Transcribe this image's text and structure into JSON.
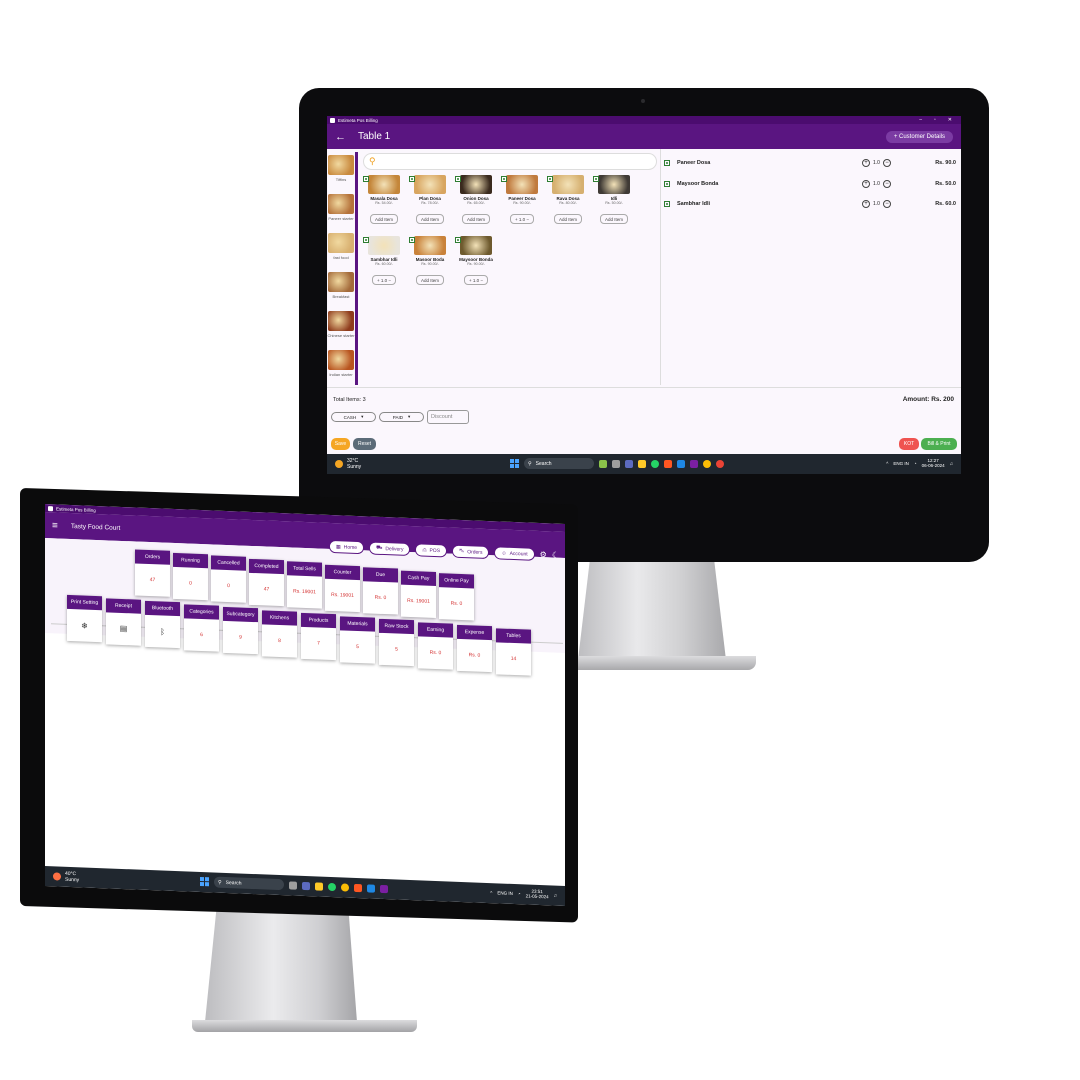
{
  "pos_screen": {
    "window_title": "Estimeta Pos Billing",
    "header_title": "Table 1",
    "customer_details_label": "+ Customer Details",
    "categories": [
      {
        "label": "Tiffins",
        "color": "#c98a3e"
      },
      {
        "label": "Paneer starter",
        "color": "#b5723a"
      },
      {
        "label": "fast food",
        "color": "#d8b070"
      },
      {
        "label": "Breakfast",
        "color": "#a36a3a"
      },
      {
        "label": "Chinese starter",
        "color": "#8e3b1c"
      },
      {
        "label": "Indian starter",
        "color": "#b8541f"
      }
    ],
    "products": [
      {
        "name": "Masala Dosa",
        "price": "Rs. 54.00/-",
        "action": "Add Item",
        "color": "#c4863a"
      },
      {
        "name": "Plan Dosa",
        "price": "Rs. 78.00/-",
        "action": "Add Item",
        "color": "#d8a560"
      },
      {
        "name": "Onion Dosa",
        "price": "Rs. 65.00/-",
        "action": "Add Item",
        "color": "#3a2a1e"
      },
      {
        "name": "Paneer Dosa",
        "price": "Rs. 90.00/-",
        "action": "+  1.0  −",
        "color": "#c07a3e"
      },
      {
        "name": "Rava Dosa",
        "price": "Rs. 80.00/-",
        "action": "Add Item",
        "color": "#d6b070"
      },
      {
        "name": "Idli",
        "price": "Rs. 50.00/-",
        "action": "Add Item",
        "color": "#3f3a35"
      },
      {
        "name": "Sambhar Idli",
        "price": "Rs. 60.00/-",
        "action": "+  1.0  −",
        "color": "#e8e4dc"
      },
      {
        "name": "Masoor Boda",
        "price": "Rs. 90.00/-",
        "action": "Add Item",
        "color": "#c9823a"
      },
      {
        "name": "Maysoor Bonda",
        "price": "Rs. 90.00/-",
        "action": "+  1.0  −",
        "color": "#6e5a2e"
      }
    ],
    "order_items": [
      {
        "name": "Paneer Dosa",
        "qty": "1.0",
        "amount": "Rs. 90.0"
      },
      {
        "name": "Maysoor Bonda",
        "qty": "1.0",
        "amount": "Rs. 50.0"
      },
      {
        "name": "Sambhar Idli",
        "qty": "1.0",
        "amount": "Rs. 60.0"
      }
    ],
    "total_items": "Total Items: 3",
    "amount": "Amount: Rs. 200",
    "payment_mode": "CASH",
    "payment_status": "PAID",
    "discount_placeholder": "Discount",
    "save_label": "Save",
    "reset_label": "Reset",
    "kot_label": "KOT",
    "bill_print_label": "Bill & Print",
    "taskbar": {
      "weather_temp": "32°C",
      "weather_text": "Sunny",
      "search": "Search",
      "lang": "ENG IN",
      "time": "12:27",
      "date": "06-06-2024"
    }
  },
  "dashboard_screen": {
    "window_title": "Estimeta Pos Billing",
    "app_title": "Tasty Food Court",
    "nav_buttons": [
      "Home",
      "Delivery",
      "POS",
      "Orders",
      "Account"
    ],
    "stats": [
      {
        "label": "Orders",
        "value": "47"
      },
      {
        "label": "Running",
        "value": "0"
      },
      {
        "label": "Cancelled",
        "value": "0"
      },
      {
        "label": "Completed",
        "value": "47"
      },
      {
        "label": "Total Sells",
        "value": "Rs. 19001"
      },
      {
        "label": "Counter",
        "value": "Rs. 19001"
      },
      {
        "label": "Due",
        "value": "Rs. 0"
      },
      {
        "label": "Cash Pay",
        "value": "Rs. 19001"
      },
      {
        "label": "Online Pay",
        "value": "Rs. 0"
      }
    ],
    "tiles": [
      {
        "label": "Print Setting",
        "value": "",
        "icon": "gear-icon"
      },
      {
        "label": "Receipt",
        "value": "",
        "icon": "receipt-icon"
      },
      {
        "label": "Bluetooth",
        "value": "",
        "icon": "bluetooth-icon"
      },
      {
        "label": "Categories",
        "value": "6"
      },
      {
        "label": "Subcategory",
        "value": "9"
      },
      {
        "label": "Kitchens",
        "value": "8"
      },
      {
        "label": "Products",
        "value": "7"
      },
      {
        "label": "Materials",
        "value": "5"
      },
      {
        "label": "Raw Stock",
        "value": "5"
      },
      {
        "label": "Earning",
        "value": "Rs. 0"
      },
      {
        "label": "Expense",
        "value": "Rs. 0"
      },
      {
        "label": "Tables",
        "value": "14"
      }
    ],
    "taskbar": {
      "weather_temp": "40°C",
      "weather_text": "Sunny",
      "search": "Search",
      "lang": "ENG IN",
      "time": "23:51",
      "date": "21-05-2024"
    }
  },
  "colors": {
    "primary": "#5a1581",
    "accent_red": "#d32f2f",
    "save": "#f5a623",
    "reset": "#5b6b78",
    "kot": "#ef5350",
    "bill": "#4caf50"
  }
}
